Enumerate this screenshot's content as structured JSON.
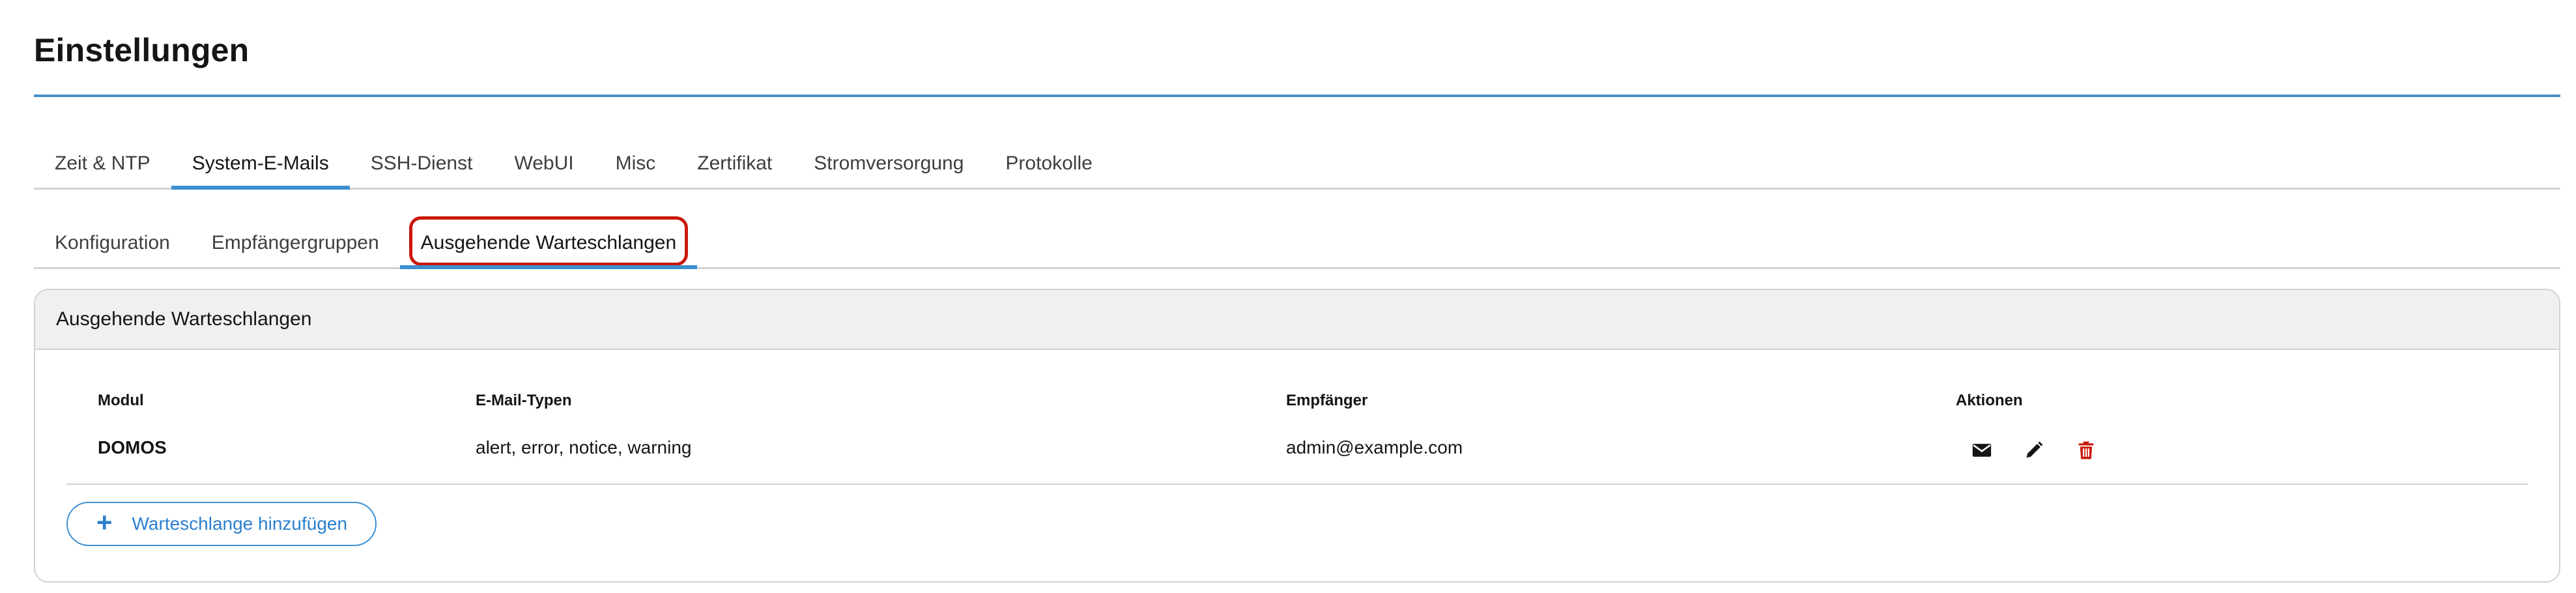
{
  "page": {
    "title": "Einstellungen"
  },
  "primary_tabs": [
    "Zeit & NTP",
    "System-E-Mails",
    "SSH-Dienst",
    "WebUI",
    "Misc",
    "Zertifikat",
    "Stromversorgung",
    "Protokolle"
  ],
  "primary_active": "System-E-Mails",
  "secondary_tabs": [
    "Konfiguration",
    "Empfängergruppen",
    "Ausgehende Warteschlangen"
  ],
  "secondary_active": "Ausgehende Warteschlangen",
  "card": {
    "title": "Ausgehende Warteschlangen",
    "columns": [
      "Modul",
      "E-Mail-Typen",
      "Empfänger",
      "Aktionen"
    ],
    "rows": [
      {
        "modul": "DOMOS",
        "typen": "alert, error, notice, warning",
        "empfaenger": "admin@example.com"
      }
    ],
    "row_actions": [
      "mail-icon",
      "pencil-icon",
      "trash-icon"
    ],
    "add_label": "Warteschlange hinzufügen"
  },
  "colors": {
    "accent": "#3d8fd1",
    "danger": "#c9190b",
    "text": "#151515"
  }
}
